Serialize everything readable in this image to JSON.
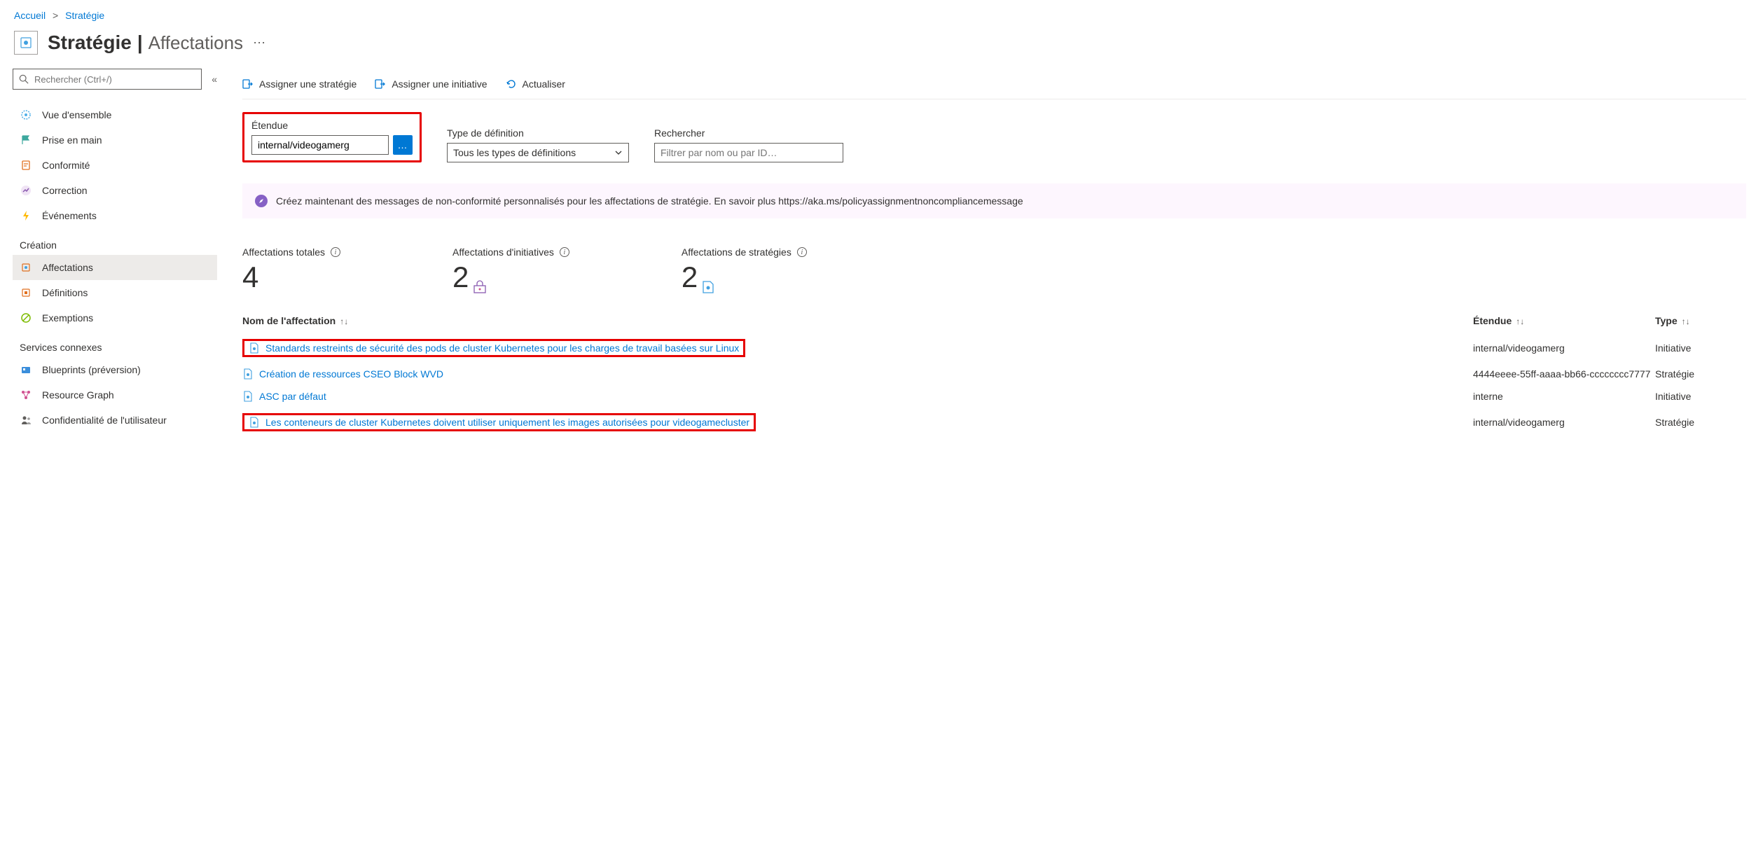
{
  "breadcrumb": {
    "home": "Accueil",
    "current": "Stratégie"
  },
  "header": {
    "title": "Stratégie",
    "subtitle": "Affectations"
  },
  "sidebar": {
    "search_placeholder": "Rechercher (Ctrl+/)",
    "items": [
      {
        "label": "Vue d'ensemble"
      },
      {
        "label": "Prise en main"
      },
      {
        "label": "Conformité"
      },
      {
        "label": "Correction"
      },
      {
        "label": "Événements"
      }
    ],
    "section1_title": "Création",
    "creation_items": [
      {
        "label": "Affectations"
      },
      {
        "label": "Définitions"
      },
      {
        "label": "Exemptions"
      }
    ],
    "section2_title": "Services connexes",
    "related_items": [
      {
        "label": "Blueprints (préversion)"
      },
      {
        "label": "Resource Graph"
      },
      {
        "label": "Confidentialité de l'utilisateur"
      }
    ]
  },
  "toolbar": {
    "assign_policy": "Assigner une stratégie",
    "assign_initiative": "Assigner une initiative",
    "refresh": "Actualiser"
  },
  "filters": {
    "scope_label": "Étendue",
    "scope_value": "internal/videogamerg",
    "scope_btn": "…",
    "deftype_label": "Type de définition",
    "deftype_value": "Tous les types de définitions",
    "search_label": "Rechercher",
    "search_placeholder": "Filtrer par nom ou par ID…"
  },
  "banner": {
    "text": "Créez maintenant des messages de non-conformité personnalisés pour les affectations de stratégie. En savoir plus https://aka.ms/policyassignmentnoncompliancemessage"
  },
  "stats": {
    "total_label": "Affectations totales",
    "total_value": "4",
    "initiative_label": "Affectations d'initiatives",
    "initiative_value": "2",
    "policy_label": "Affectations de stratégies",
    "policy_value": "2"
  },
  "table": {
    "col_name": "Nom de l'affectation",
    "col_scope": "Étendue",
    "col_type": "Type",
    "rows": [
      {
        "name": "Standards restreints de sécurité des pods de cluster Kubernetes pour les charges de travail basées sur Linux",
        "scope": "internal/videogamerg",
        "type": "Initiative",
        "highlight": true
      },
      {
        "name": "Création de ressources CSEO Block WVD",
        "scope": "4444eeee-55ff-aaaa-bb66-cccccccc7777",
        "type": "Stratégie",
        "highlight": false
      },
      {
        "name": "ASC par défaut",
        "scope": "interne",
        "type": "Initiative",
        "highlight": false
      },
      {
        "name": "Les conteneurs de cluster Kubernetes doivent utiliser uniquement les images autorisées pour videogamecluster",
        "scope": "internal/videogamerg",
        "type": "Stratégie",
        "highlight": true
      }
    ]
  }
}
